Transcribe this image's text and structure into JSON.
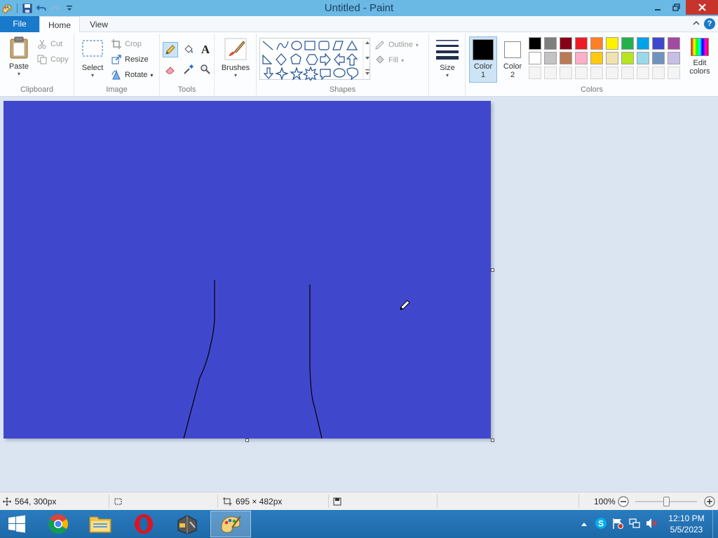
{
  "window": {
    "title": "Untitled - Paint"
  },
  "tabs": {
    "file": "File",
    "home": "Home",
    "view": "View"
  },
  "ribbon": {
    "clipboard": {
      "label": "Clipboard",
      "paste": "Paste",
      "cut": "Cut",
      "copy": "Copy"
    },
    "image": {
      "label": "Image",
      "select": "Select",
      "crop": "Crop",
      "resize": "Resize",
      "rotate": "Rotate"
    },
    "tools": {
      "label": "Tools"
    },
    "brushes": {
      "label": "Brushes"
    },
    "shapes": {
      "label": "Shapes",
      "outline": "Outline",
      "fill": "Fill"
    },
    "size": {
      "label": "Size"
    },
    "colors": {
      "label": "Colors",
      "color1": "Color",
      "color1_num": "1",
      "color2": "Color",
      "color2_num": "2",
      "edit": "Edit",
      "edit2": "colors",
      "color1_value": "#000000",
      "color2_value": "#ffffff",
      "palette_row1": [
        "#000000",
        "#7f7f7f",
        "#880015",
        "#ed1c24",
        "#ff7f27",
        "#fff200",
        "#22b14c",
        "#00a2e8",
        "#3f48cc",
        "#a349a4"
      ],
      "palette_row2": [
        "#ffffff",
        "#c3c3c3",
        "#b97a57",
        "#ffaec9",
        "#ffc90e",
        "#efe4b0",
        "#b5e61d",
        "#99d9ea",
        "#7092be",
        "#c8bfe7"
      ]
    }
  },
  "canvas": {
    "fill": "#3f48cc"
  },
  "status": {
    "cursor": "564, 300px",
    "dimensions": "695 × 482px",
    "zoom": "100%"
  },
  "clock": {
    "time": "12:10 PM",
    "date": "5/5/2023"
  }
}
